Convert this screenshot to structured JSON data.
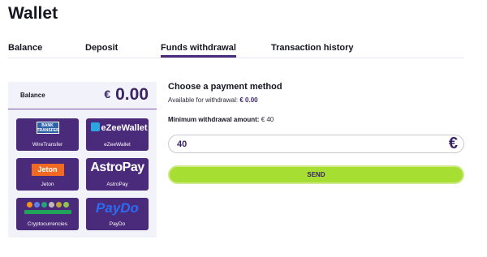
{
  "page": {
    "title": "Wallet"
  },
  "tabs": [
    {
      "label": "Balance",
      "active": false
    },
    {
      "label": "Deposit",
      "active": false
    },
    {
      "label": "Funds withdrawal",
      "active": true
    },
    {
      "label": "Transaction history",
      "active": false
    }
  ],
  "balance": {
    "label": "Balance",
    "currency": "€",
    "amount": "0.00"
  },
  "methods": [
    {
      "name": "WireTransfer",
      "logo_text": "BANK TRANSFER",
      "icon": "bank-transfer-logo"
    },
    {
      "name": "eZeeWallet",
      "logo_text": "eZeeWallet",
      "icon": "ezeewallet-logo"
    },
    {
      "name": "Jeton",
      "logo_text": "Jeton",
      "icon": "jeton-logo"
    },
    {
      "name": "AstroPay",
      "logo_text": "AstroPay",
      "icon": "astropay-logo"
    },
    {
      "name": "Cryptocurrencies",
      "icon": "cryptocurrencies-logo"
    },
    {
      "name": "PayDo",
      "logo_text": "PayDo",
      "icon": "paydo-logo"
    }
  ],
  "withdrawal": {
    "heading": "Choose a payment method",
    "available_label": "Available for withdrawal:",
    "available_value": "€ 0.00",
    "minimum_label": "Minimum withdrawal amount:",
    "minimum_value": "€ 40",
    "amount_value": "40",
    "amount_currency": "€",
    "send_label": "SEND"
  },
  "colors": {
    "brand_purple": "#4a2a7a",
    "accent_green": "#a6df32",
    "panel_bg": "#f2f3fa"
  }
}
